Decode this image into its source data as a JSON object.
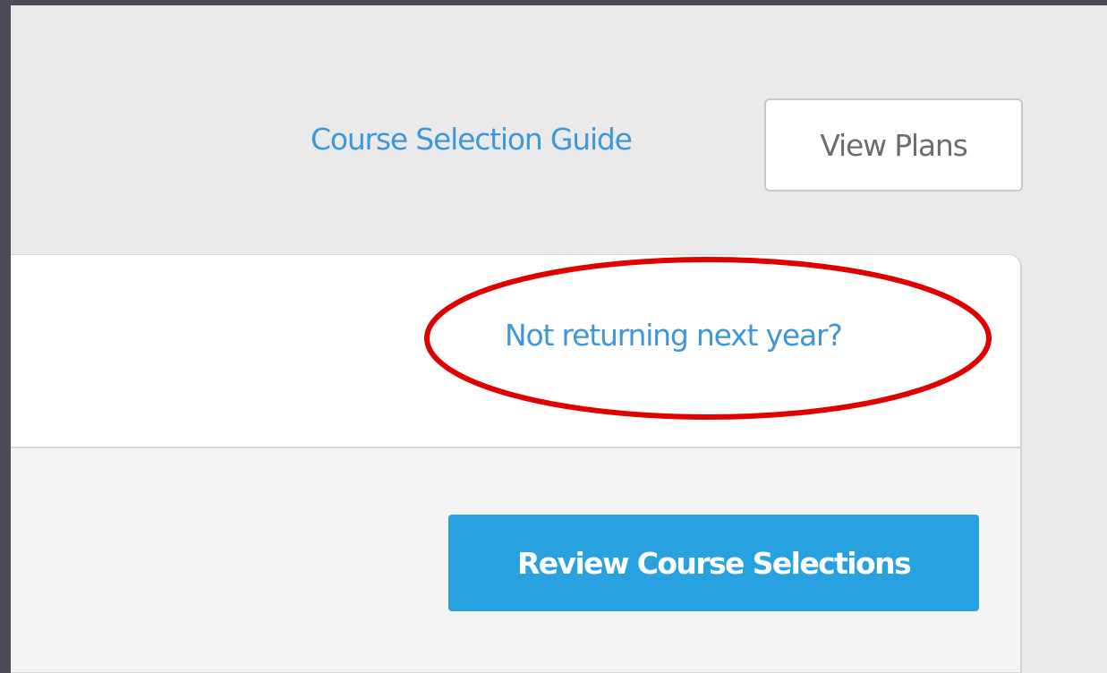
{
  "header": {
    "guide_link": "Course Selection Guide",
    "view_plans_button": "View Plans"
  },
  "card": {
    "not_returning_link": "Not returning next year?",
    "review_button": "Review Course Selections"
  },
  "colors": {
    "link": "#3f97d6",
    "primary_button": "#27a1e0",
    "annotation": "#e00000",
    "backdrop": "#4a4b57",
    "page_background": "#eaeaea"
  },
  "annotation": {
    "shape": "ellipse",
    "target": "not-returning-link"
  }
}
